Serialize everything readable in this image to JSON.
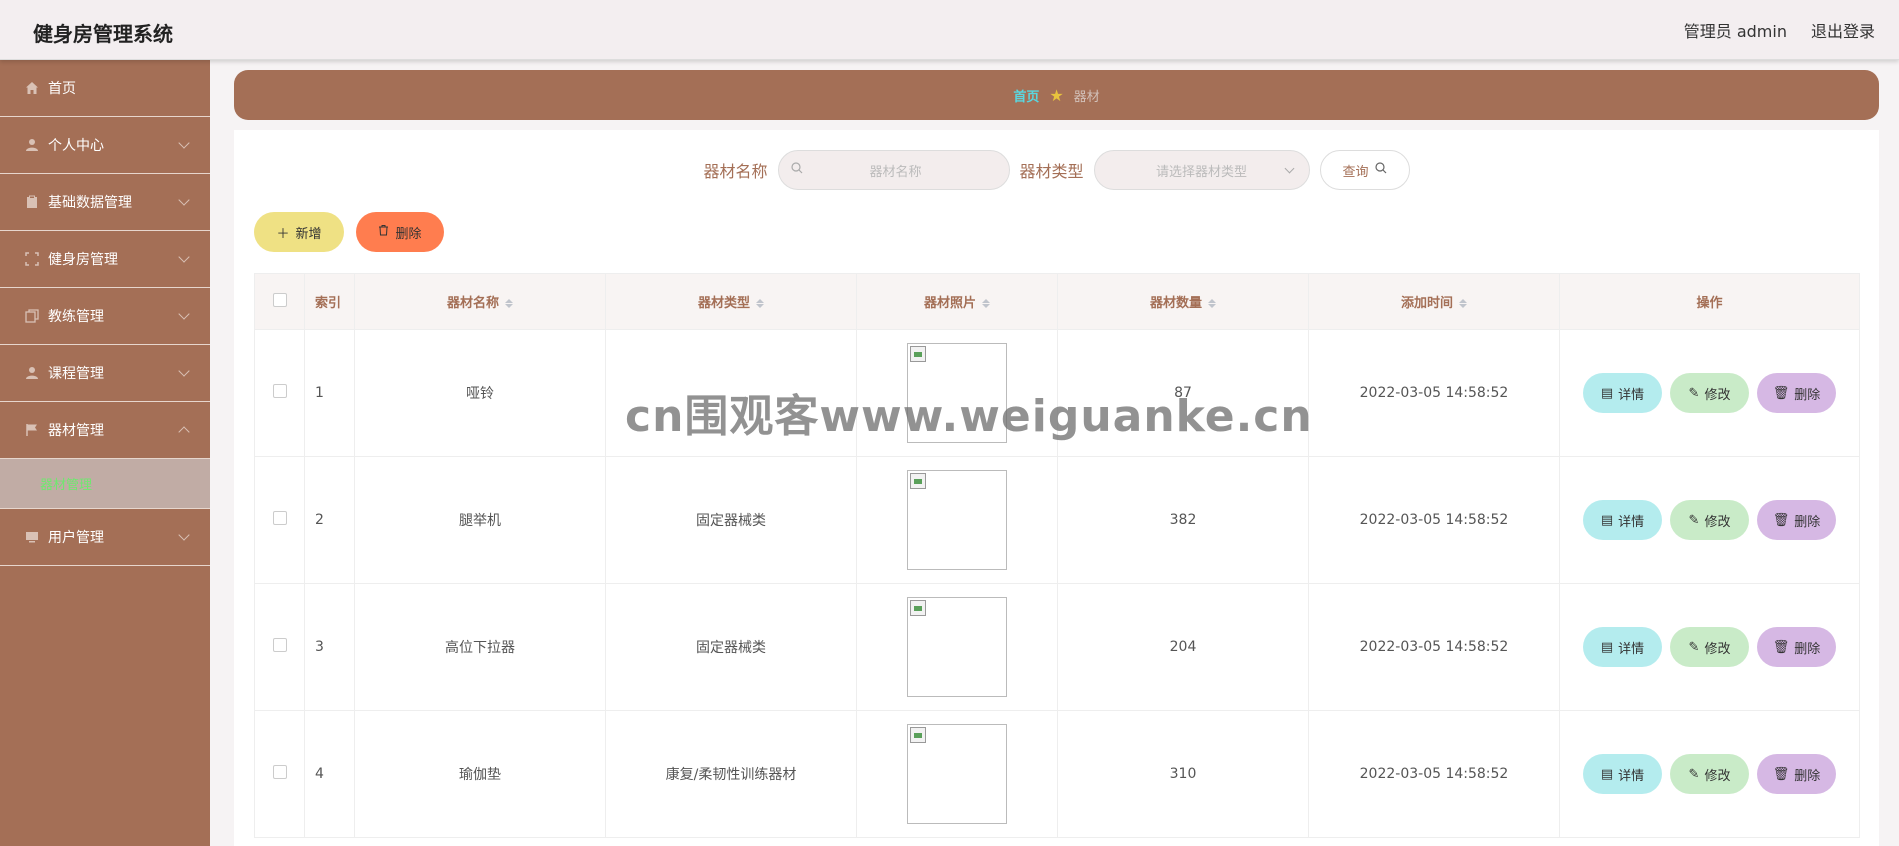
{
  "header": {
    "title": "健身房管理系统",
    "user": "管理员 admin",
    "logout": "退出登录"
  },
  "sidebar": {
    "items": [
      {
        "label": "首页",
        "icon": "home-icon"
      },
      {
        "label": "个人中心",
        "icon": "user-icon"
      },
      {
        "label": "基础数据管理",
        "icon": "clipboard-icon"
      },
      {
        "label": "健身房管理",
        "icon": "fullscreen-icon"
      },
      {
        "label": "教练管理",
        "icon": "copy-icon"
      },
      {
        "label": "课程管理",
        "icon": "user-icon"
      },
      {
        "label": "器材管理",
        "icon": "flag-icon"
      },
      {
        "label": "用户管理",
        "icon": "monitor-icon"
      }
    ],
    "sub_item": "器材管理"
  },
  "breadcrumb": {
    "home": "首页",
    "current": "器材"
  },
  "search": {
    "name_label": "器材名称",
    "name_placeholder": "器材名称",
    "type_label": "器材类型",
    "type_placeholder": "请选择器材类型",
    "query": "查询"
  },
  "actions": {
    "add": "新增",
    "delete": "删除"
  },
  "table": {
    "headers": {
      "index": "索引",
      "name": "器材名称",
      "type": "器材类型",
      "photo": "器材照片",
      "count": "器材数量",
      "time": "添加时间",
      "ops": "操作"
    },
    "rows": [
      {
        "index": "1",
        "name": "哑铃",
        "type": "",
        "count": "87",
        "time": "2022-03-05 14:58:52"
      },
      {
        "index": "2",
        "name": "腿举机",
        "type": "固定器械类",
        "count": "382",
        "time": "2022-03-05 14:58:52"
      },
      {
        "index": "3",
        "name": "高位下拉器",
        "type": "固定器械类",
        "count": "204",
        "time": "2022-03-05 14:58:52"
      },
      {
        "index": "4",
        "name": "瑜伽垫",
        "type": "康复/柔韧性训练器材",
        "count": "310",
        "time": "2022-03-05 14:58:52"
      }
    ],
    "op_labels": {
      "detail": "详情",
      "edit": "修改",
      "remove": "删除"
    }
  },
  "watermark": "cn围观客www.weiguanke.cn",
  "colors": {
    "brand": "#a46f56",
    "add": "#efe184",
    "delete": "#ff7d4f",
    "detail": "#b4ecee",
    "edit": "#c9ebc8",
    "remove": "#d6b8e4"
  }
}
